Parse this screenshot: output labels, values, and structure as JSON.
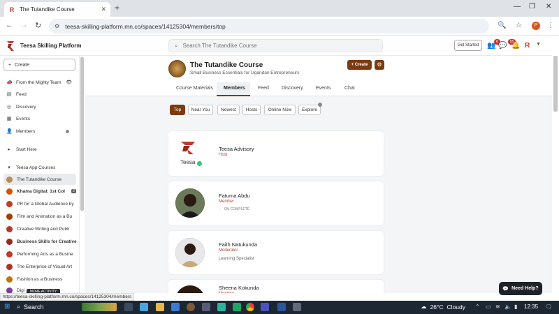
{
  "browser": {
    "tab_title": "The Tutandike Course",
    "url": "teesa-skilling-platform.mn.co/spaces/14125304/members/top",
    "profile_initial": "P",
    "new_tab": "+",
    "status_url": "https://teesa-skilling-platform.mn.co/spaces/14125304/members"
  },
  "header": {
    "platform_name": "Teesa Skilling Platform",
    "search_placeholder": "Search The Tutandike Course",
    "get_started": "Get Started",
    "badge_notifications": "6",
    "badge_messages": "55"
  },
  "sidebar": {
    "create_label": "Create",
    "items": [
      {
        "label": "From the Mighty Team",
        "icon": "megaphone-icon"
      },
      {
        "label": "Feed",
        "icon": "feed-icon"
      },
      {
        "label": "Discovery",
        "icon": "compass-icon"
      },
      {
        "label": "Events",
        "icon": "calendar-icon"
      },
      {
        "label": "Members",
        "icon": "members-icon"
      }
    ],
    "start_here": "Start Here",
    "section_title": "Teesa App Courses",
    "courses": [
      {
        "label": "The Tutandike Course"
      },
      {
        "label": "Khama Digital: 1st Col",
        "count": "2"
      },
      {
        "label": "PR for a Global Audience by"
      },
      {
        "label": "Film and Animation as a Bu"
      },
      {
        "label": "Creative Writing and Publi"
      },
      {
        "label": "Business Skills for Creative"
      },
      {
        "label": "Performing Arts as a Busine"
      },
      {
        "label": "The Enterprise of Visual Art"
      },
      {
        "label": "Fashion as a Business"
      },
      {
        "label": "Digi"
      }
    ],
    "more_activity": "MORE ACTIVITY"
  },
  "space": {
    "title": "The Tutandike Course",
    "subtitle": "Small Business Essentials for Ugandan Entrepreneurs",
    "create_label": "+ Create",
    "tabs": [
      "Course Materials",
      "Members",
      "Feed",
      "Discovery",
      "Events",
      "Chat"
    ],
    "active_tab": "Members"
  },
  "filters": [
    "Top",
    "Near You",
    "Newest",
    "Hosts",
    "Online Now",
    "Explore"
  ],
  "members": [
    {
      "name": "Teesa Advisory",
      "role": "Host",
      "logo_text": "Teesa"
    },
    {
      "name": "Fatuma Abdu",
      "role": "Member",
      "extra": "0% COMPLETE"
    },
    {
      "name": "Faith Natukunda",
      "role": "Moderator",
      "extra": "Learning Specialist"
    },
    {
      "name": "Sheena Kokunda",
      "role": "Member"
    }
  ],
  "help": {
    "label": "Need Help?"
  },
  "taskbar": {
    "search_label": "Search",
    "temperature": "26°C",
    "weather": "Cloudy",
    "time": "12:35"
  },
  "colors": {
    "accent": "#7b3b10",
    "role_red": "#c0392b",
    "taskbar": "#1d2633"
  }
}
